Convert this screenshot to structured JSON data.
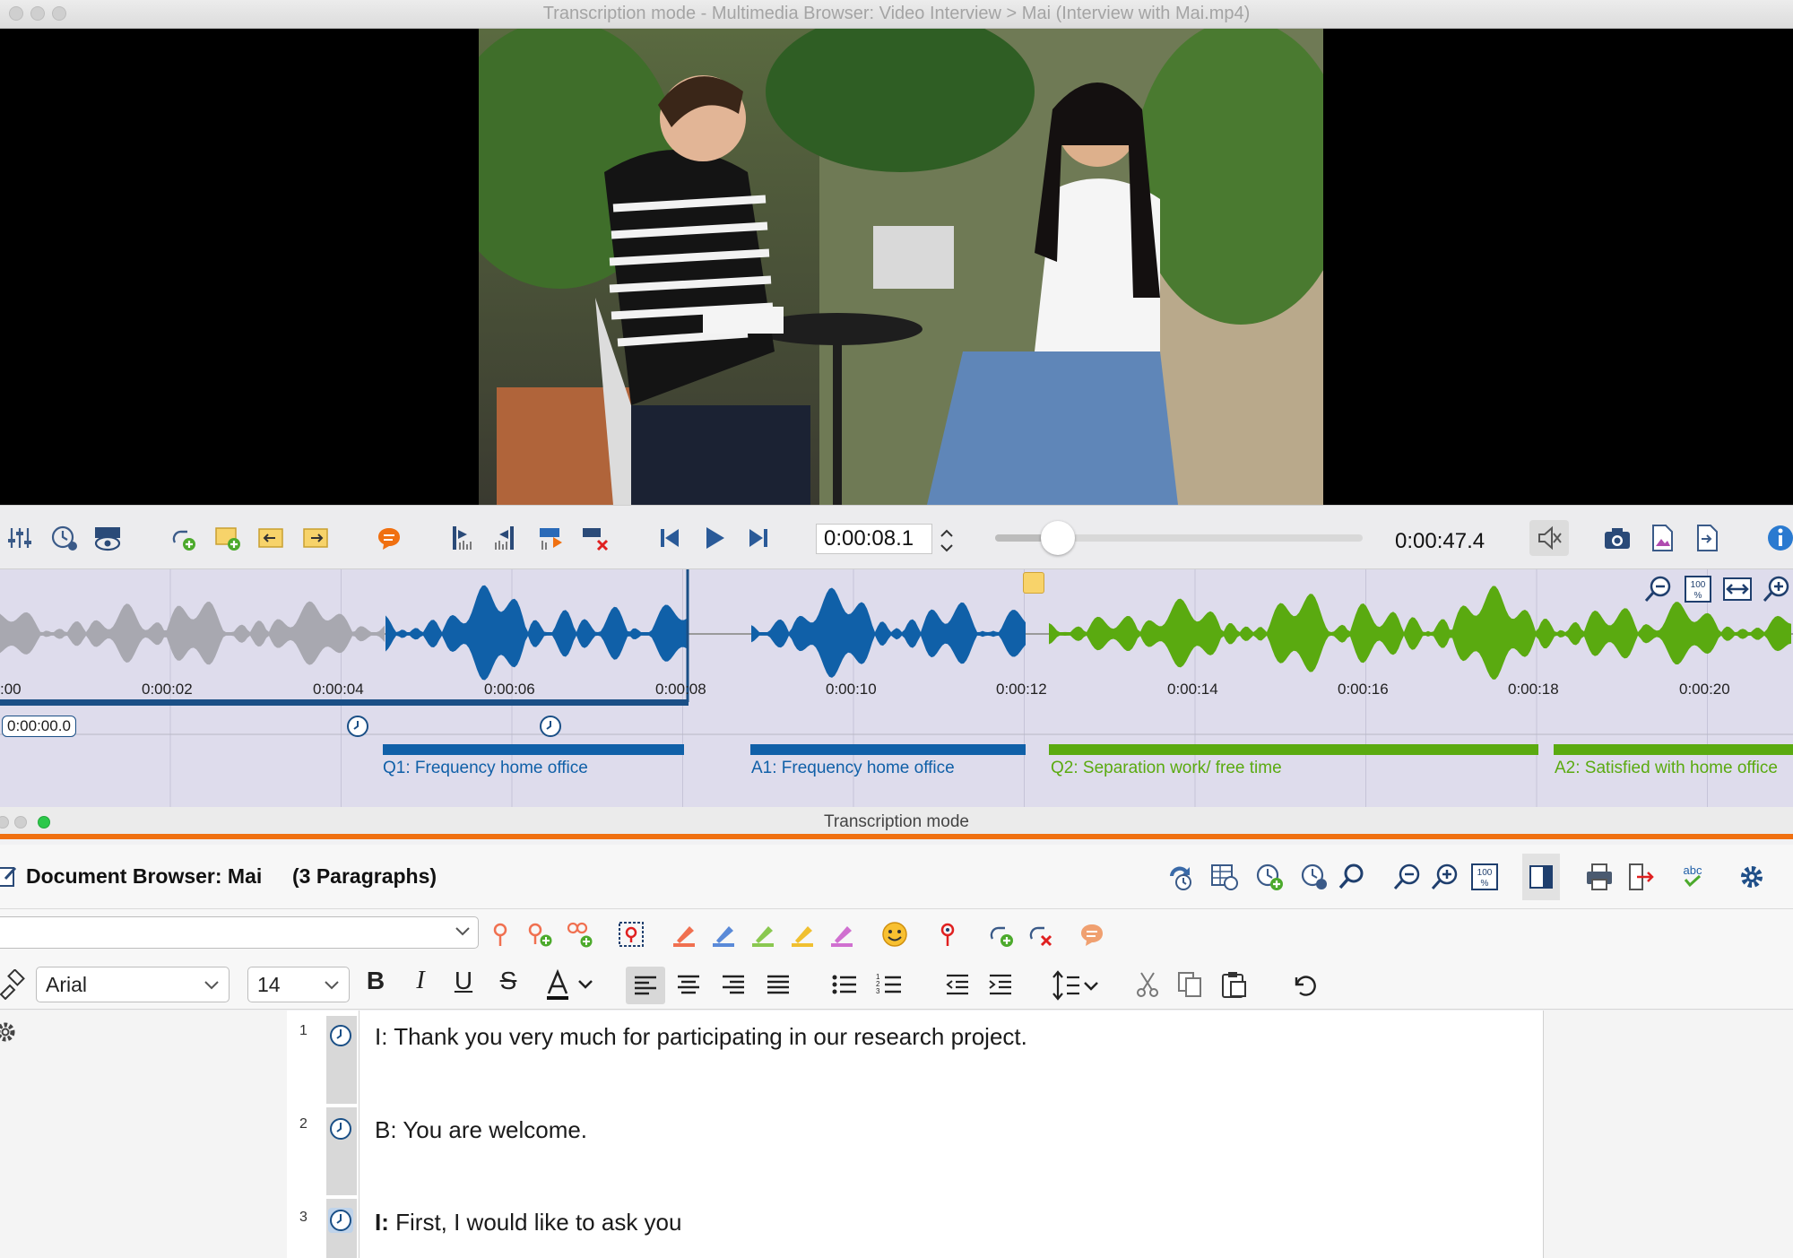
{
  "window": {
    "title": "Transcription mode - Multimedia Browser: Video Interview > Mai (Interview with Mai.mp4)"
  },
  "player": {
    "current_time": "0:00:08.1",
    "total_time": "0:00:47.4",
    "progress": 0.17
  },
  "waveform": {
    "ticks": [
      ":00",
      "0:00:02",
      "0:00:04",
      "0:00:06",
      "0:00:08",
      "0:00:10",
      "0:00:12",
      "0:00:14",
      "0:00:16",
      "0:00:18",
      "0:00:20"
    ],
    "cursor_time": "0:00:00.0"
  },
  "segments": [
    {
      "label": "Q1: Frequency home office",
      "color": "#1060a8"
    },
    {
      "label": "A1: Frequency home office",
      "color": "#1060a8"
    },
    {
      "label": "Q2: Separation work/ free time",
      "color": "#5aaa10"
    },
    {
      "label": "A2: Satisfied with home office",
      "color": "#5aaa10"
    }
  ],
  "doc_window": {
    "title": "Transcription mode"
  },
  "doc": {
    "title": "Document Browser: Mai",
    "paragraph_count": "(3 Paragraphs)"
  },
  "format": {
    "font": "Arial",
    "size": "14"
  },
  "paragraphs": [
    {
      "num": "1",
      "text": "I: Thank you very much for participating in our research project."
    },
    {
      "num": "2",
      "text": "B: You are welcome."
    },
    {
      "num": "3",
      "speaker": "I:",
      "text": "First, I would like to ask you"
    }
  ],
  "colors": {
    "question": "#1060a8",
    "answer": "#5aaa10",
    "accent": "#f07010"
  }
}
